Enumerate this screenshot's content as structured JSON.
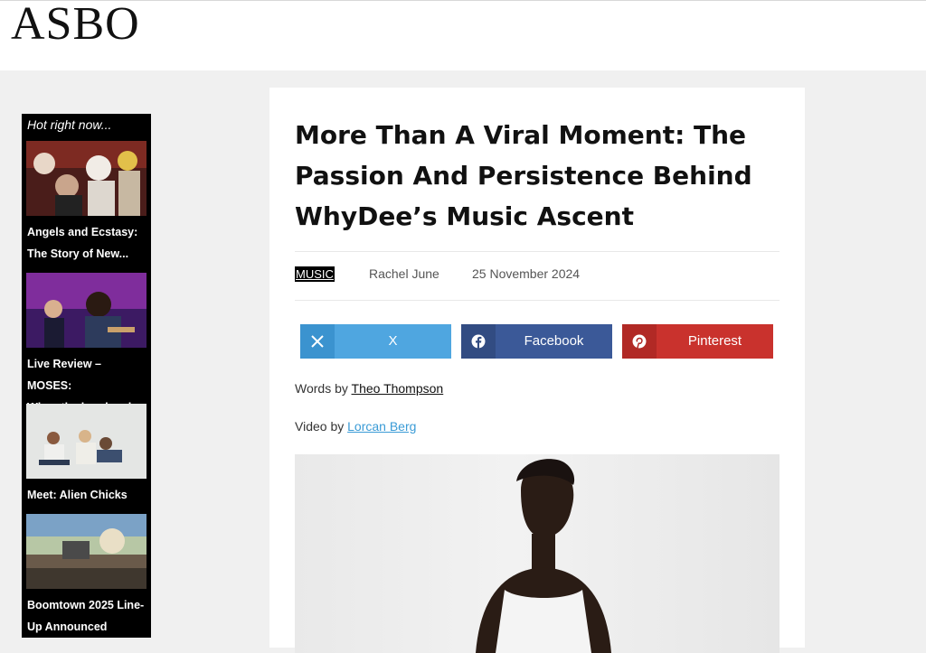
{
  "site": {
    "logo": "ASBO"
  },
  "sidebar": {
    "title": "Hot right now...",
    "items": [
      {
        "label_line1": "Angels and Ecstasy:",
        "label_line2": "The Story of New..."
      },
      {
        "label_line1": "Live Review – MOSES:",
        "label_line2": "When the band and..."
      },
      {
        "label_line1": "Meet: Alien Chicks",
        "label_line2": ""
      },
      {
        "label_line1": "Boomtown 2025 Line-",
        "label_line2": "Up Announced"
      }
    ]
  },
  "article": {
    "title": "More Than A Viral Moment: The Passion And Persistence Behind WhyDee’s Music Ascent",
    "category": "MUSIC",
    "author": "Rachel June",
    "date": "25 November 2024",
    "words_prefix": "Words by ",
    "words_author": "Theo Thompson",
    "video_prefix": "Video by ",
    "video_author": "Lorcan Berg"
  },
  "share": {
    "x_label": "X",
    "facebook_label": "Facebook",
    "pinterest_label": "Pinterest",
    "colors": {
      "x": "#4fa6e0",
      "x_icon_bg": "#3b93cf",
      "facebook": "#3b5998",
      "facebook_icon_bg": "#324c82",
      "pinterest": "#c9322d",
      "pinterest_icon_bg": "#b12925"
    }
  }
}
